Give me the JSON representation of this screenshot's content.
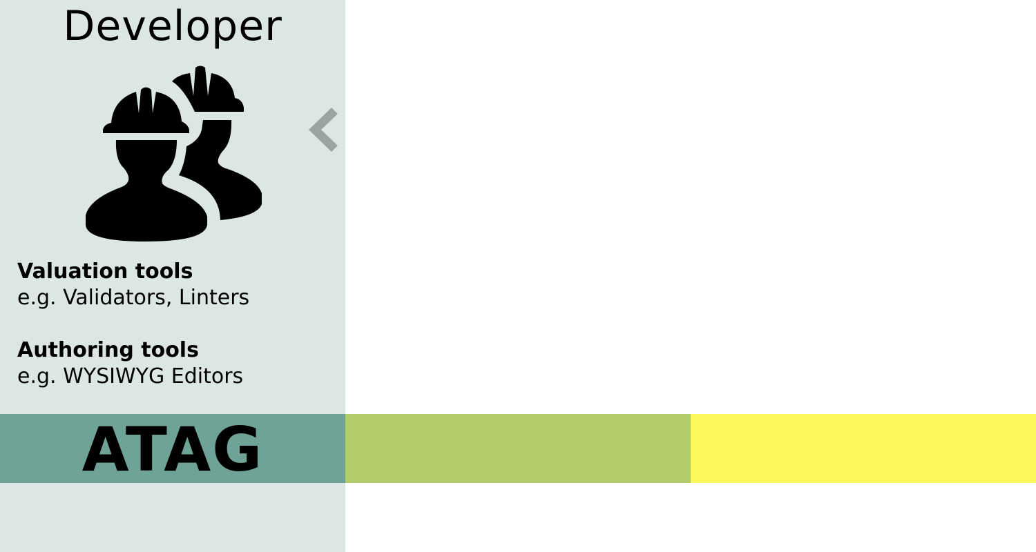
{
  "developer_panel": {
    "title": "Developer",
    "icon": "construction-workers-icon",
    "tools": [
      {
        "title": "Valuation tools",
        "description": "e.g. Validators, Linters"
      },
      {
        "title": "Authoring tools",
        "description": "e.g. WYSIWYG Editors"
      }
    ],
    "collapse_icon": "chevron-left-icon"
  },
  "bands": {
    "atag_label": "ATAG"
  },
  "colors": {
    "panel_background": "#dce7e4",
    "atag_band": "#6fa397",
    "green_band": "#b3cc6b",
    "yellow_band": "#fbf95e",
    "chevron": "#9aa5a3"
  }
}
